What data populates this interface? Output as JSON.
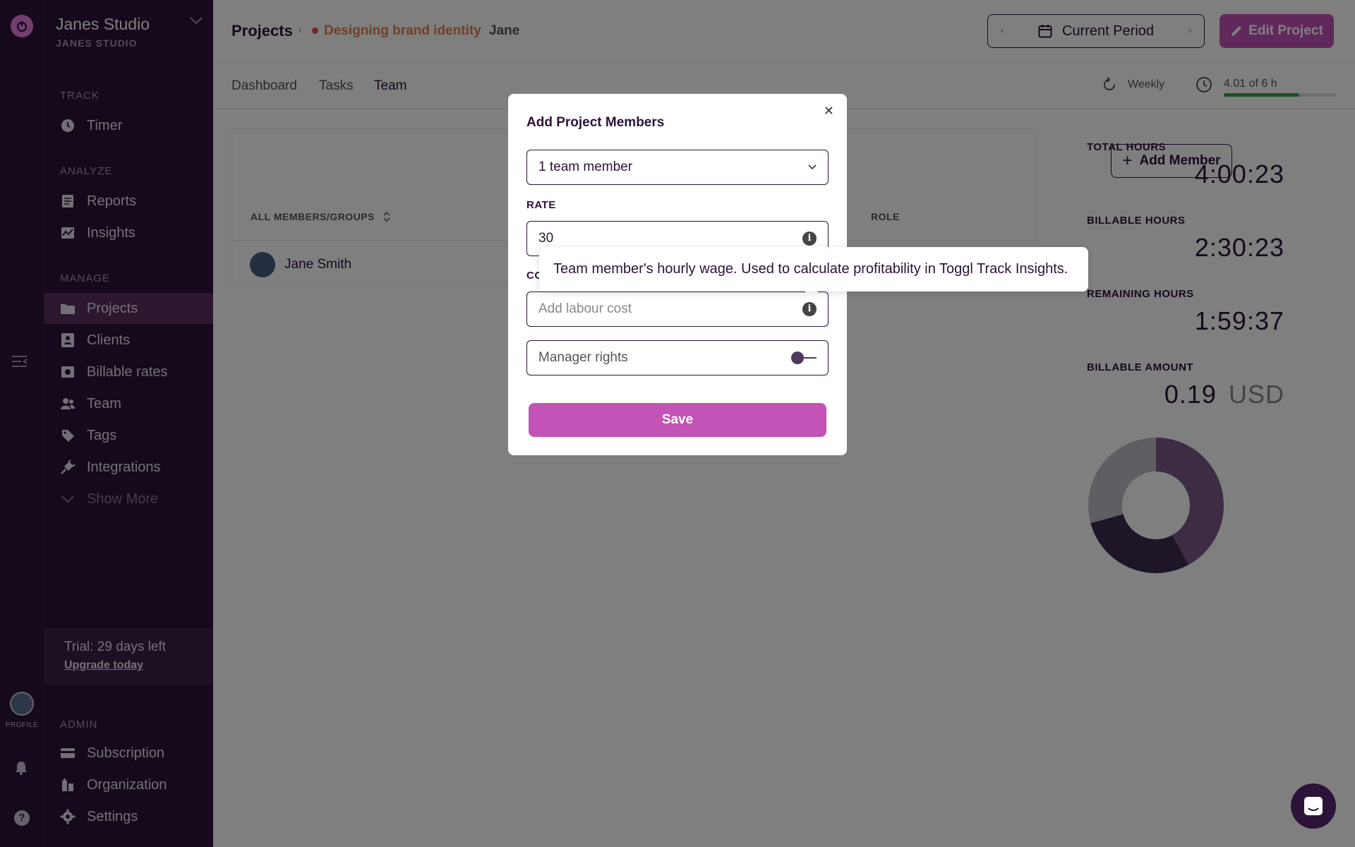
{
  "rail": {
    "profile_label": "PROFILE",
    "help_label": "?"
  },
  "sidebar": {
    "workspace_title": "Janes Studio",
    "workspace_subtitle": "JANES STUDIO",
    "sections": {
      "track": "TRACK",
      "analyze": "ANALYZE",
      "manage": "MANAGE",
      "admin": "ADMIN"
    },
    "items": {
      "timer": "Timer",
      "reports": "Reports",
      "insights": "Insights",
      "projects": "Projects",
      "clients": "Clients",
      "billable_rates": "Billable rates",
      "team": "Team",
      "tags": "Tags",
      "integrations": "Integrations",
      "show_more": "Show More",
      "subscription": "Subscription",
      "organization": "Organization",
      "settings": "Settings"
    },
    "trial": {
      "text": "Trial: 29 days left",
      "link": "Upgrade today"
    }
  },
  "header": {
    "breadcrumb_projects": "Projects",
    "project_name": "Designing brand identity",
    "client_name": "Jane",
    "period_label": "Current Period",
    "edit_button": "Edit Project"
  },
  "tabs": {
    "dashboard": "Dashboard",
    "tasks": "Tasks",
    "team": "Team",
    "weekly": "Weekly",
    "progress_text": "4.01 of 6 h",
    "progress_fraction": 0.67
  },
  "team_table": {
    "add_member": "Add Member",
    "col_members": "ALL MEMBERS/GROUPS",
    "col_role": "ROLE",
    "rows": [
      {
        "name": "Jane Smith"
      }
    ]
  },
  "stats": {
    "total_hours_label": "TOTAL HOURS",
    "total_hours": "4:00:23",
    "billable_hours_label": "BILLABLE HOURS",
    "billable_hours": "2:30:23",
    "remaining_hours_label": "REMAINING HOURS",
    "remaining_hours": "1:59:37",
    "billable_amount_label": "BILLABLE AMOUNT",
    "billable_amount": "0.19",
    "billable_currency": "USD"
  },
  "modal": {
    "title": "Add Project Members",
    "member_select": "1 team member",
    "rate_label": "RATE",
    "rate_value": "30",
    "cost_label": "CO",
    "cost_placeholder": "Add labour cost",
    "manager_rights": "Manager rights",
    "save": "Save",
    "tooltip": "Team member's hourly wage. Used to calculate profitability in Toggl Track Insights."
  },
  "colors": {
    "brand_purple": "#2c1338",
    "accent_pink": "#c353b7",
    "progress_green": "#2da650"
  }
}
